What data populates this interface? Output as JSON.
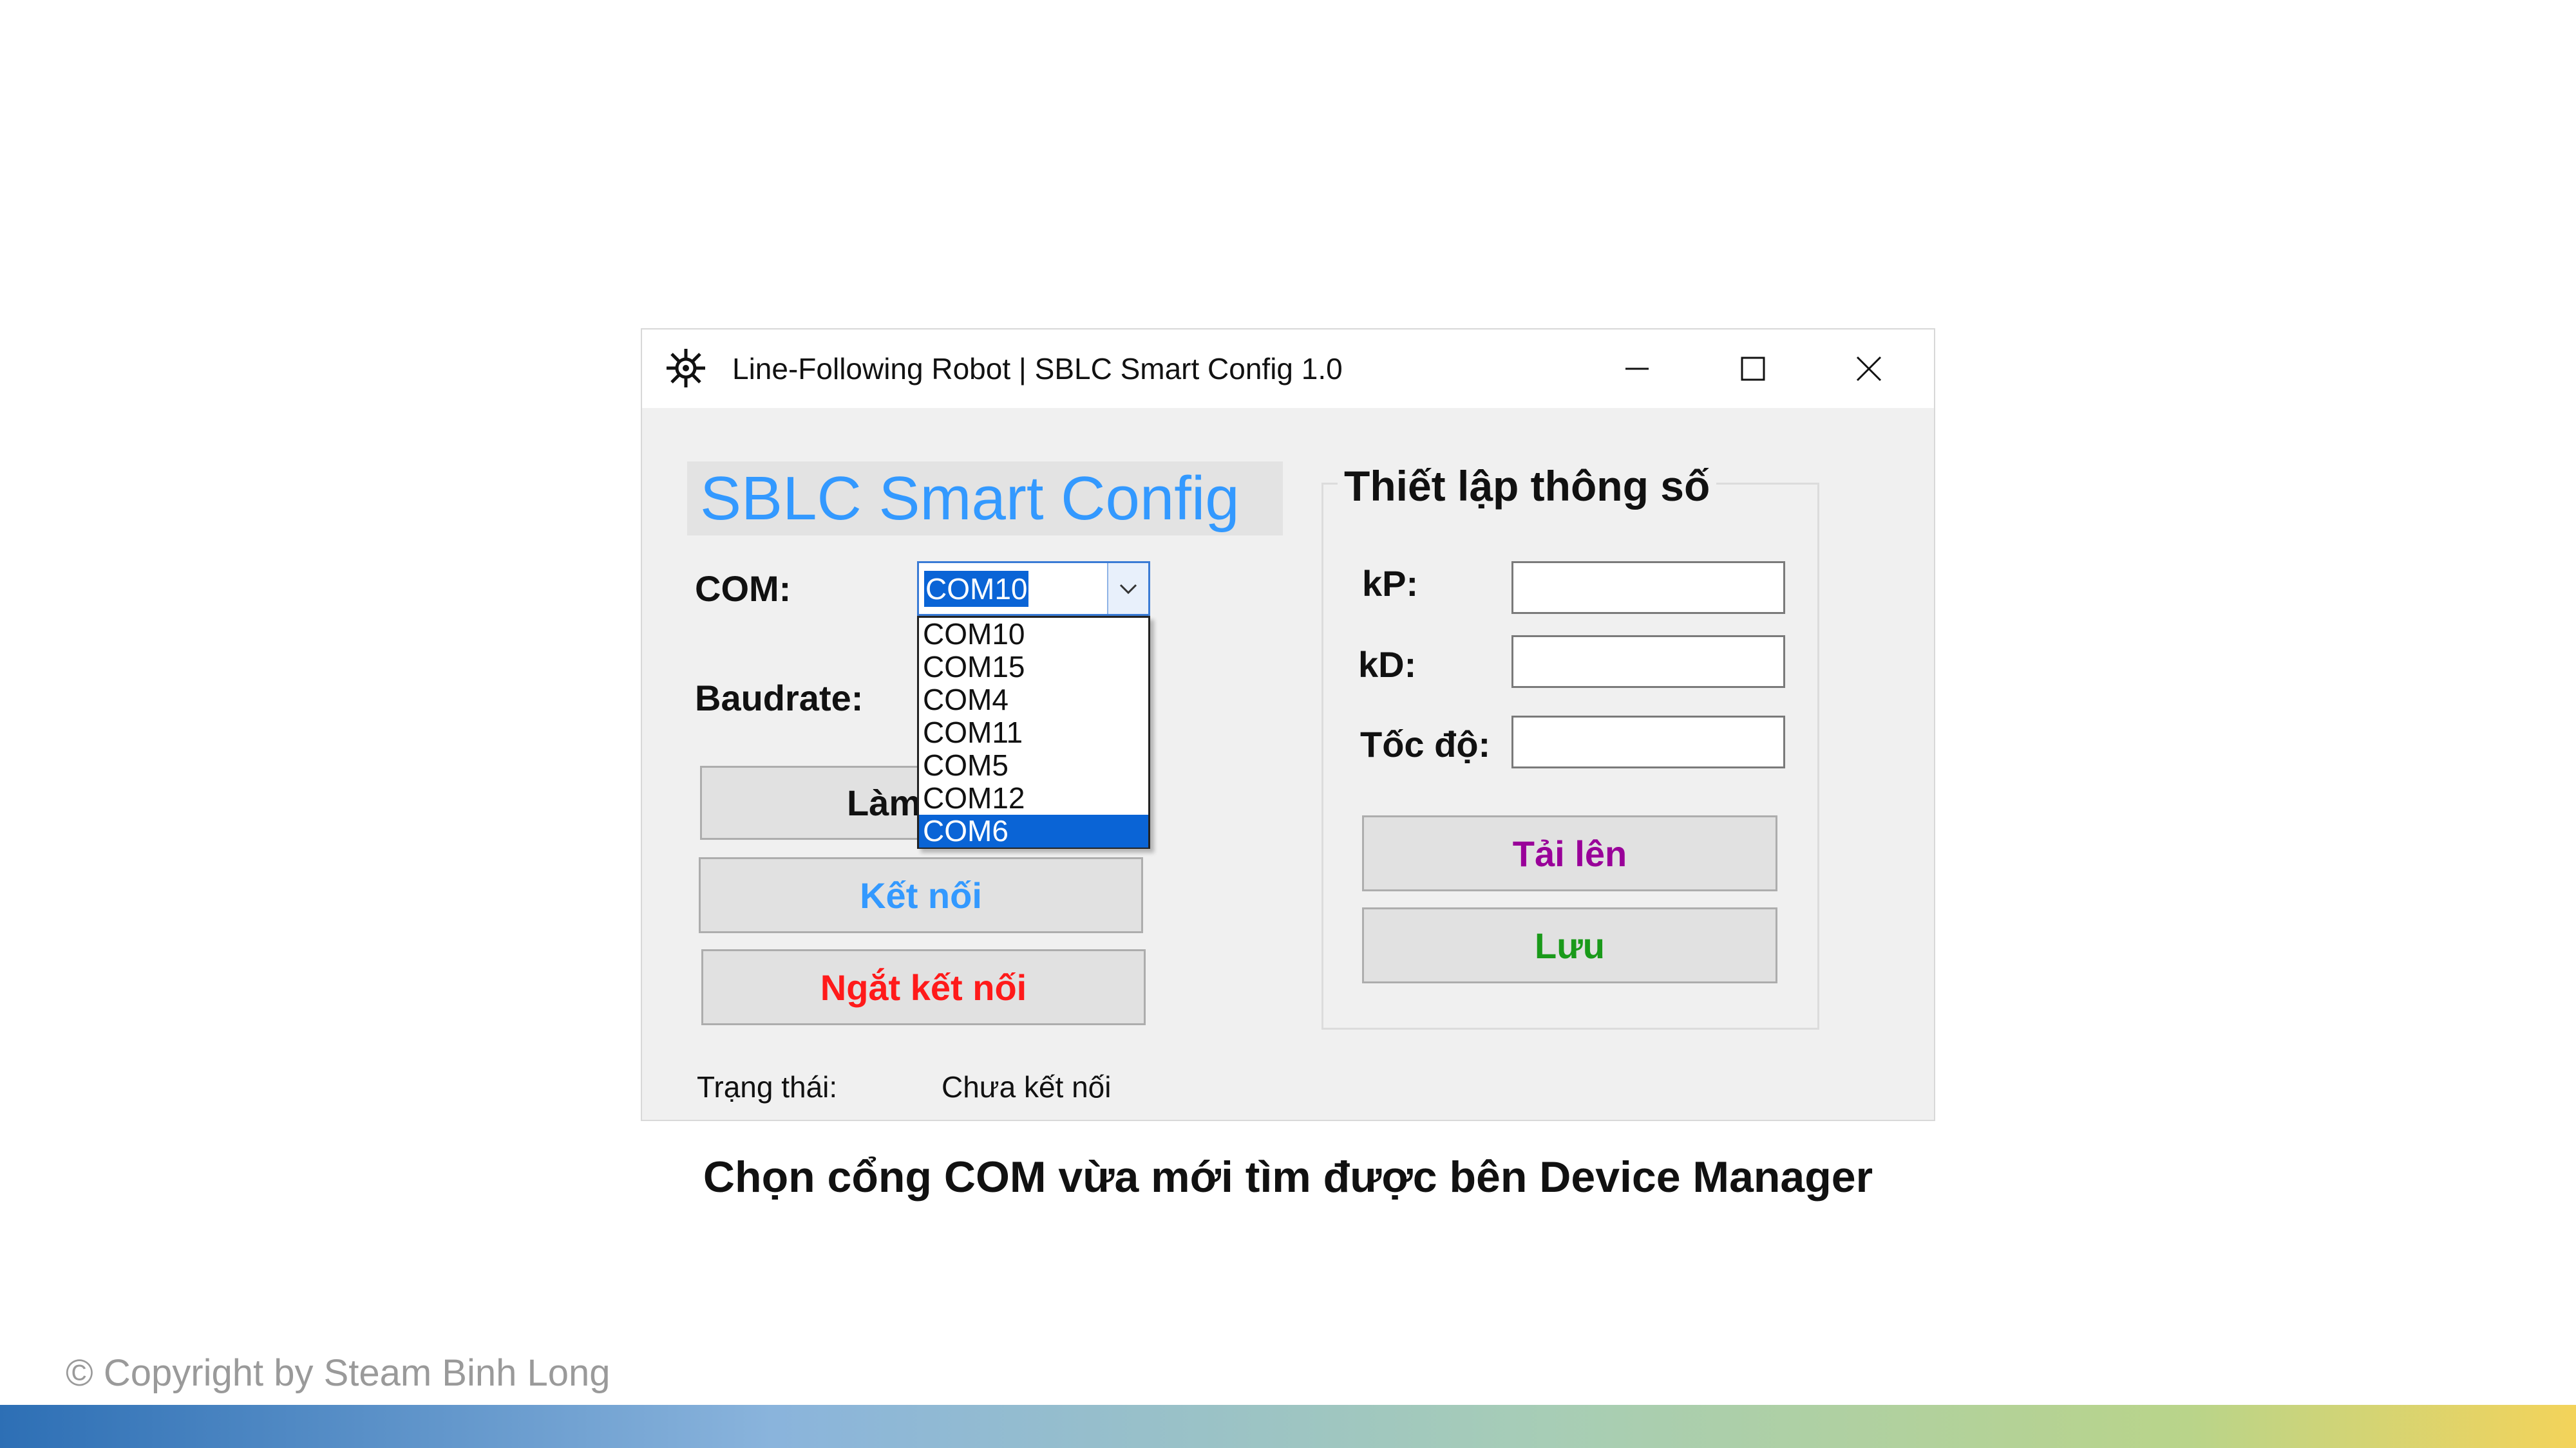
{
  "window": {
    "title": "Line-Following Robot | SBLC Smart Config 1.0",
    "icons": {
      "app": "robot-gear-icon",
      "minimize": "minimize-icon",
      "maximize": "maximize-icon",
      "close": "close-icon"
    }
  },
  "brand": {
    "text": "SBLC Smart Config",
    "color": "#3399ff"
  },
  "connection": {
    "com_label": "COM:",
    "com_selected": "COM10",
    "com_options": [
      "COM10",
      "COM15",
      "COM4",
      "COM11",
      "COM5",
      "COM12",
      "COM6"
    ],
    "com_highlighted": "COM6",
    "baud_label": "Baudrate:",
    "refresh_button": "Làm",
    "connect_button": "Kết nối",
    "disconnect_button": "Ngắt kết nối",
    "status_label": "Trạng thái:",
    "status_value": "Chưa kết nối"
  },
  "params": {
    "title": "Thiết lập thông số",
    "kp_label": "kP:",
    "kd_label": "kD:",
    "speed_label": "Tốc độ:",
    "kp_value": "",
    "kd_value": "",
    "speed_value": "",
    "upload_button": "Tải lên",
    "save_button": "Lưu"
  },
  "colors": {
    "connect": "#3399ff",
    "disconnect": "#ff1a1a",
    "upload": "#990099",
    "save": "#1a9a1a",
    "selection": "#0a64d6"
  },
  "caption": "Chọn cổng COM vừa mới tìm được bên Device Manager",
  "copyright": "© Copyright by Steam Binh Long"
}
